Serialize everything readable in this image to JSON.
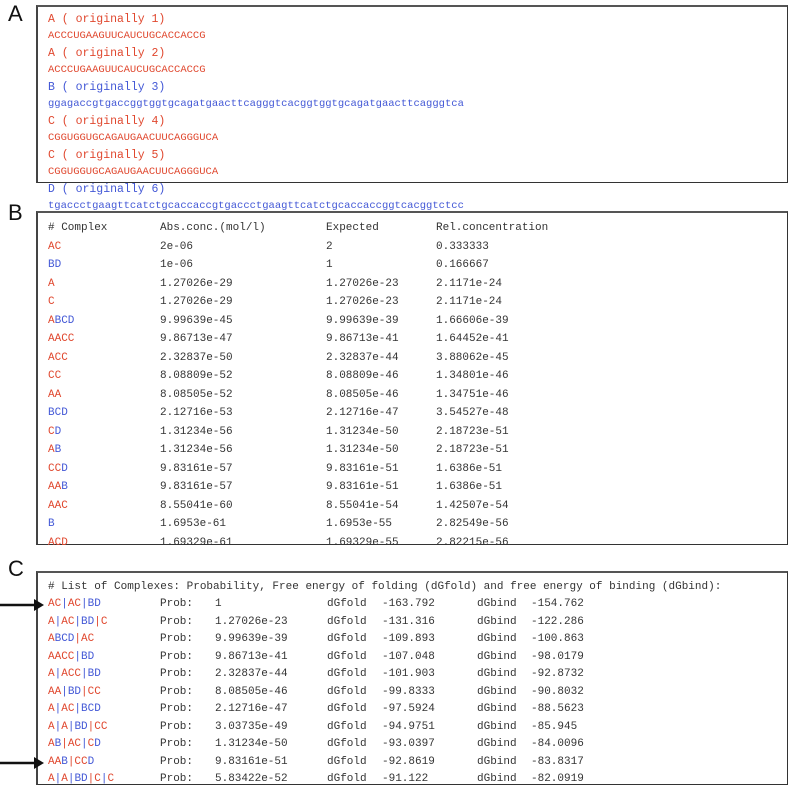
{
  "colors": {
    "strand_red": "#e0482f",
    "strand_blue": "#4358d6",
    "text": "#333333"
  },
  "red_strands": [
    "A",
    "C"
  ],
  "blue_strands": [
    "B",
    "D"
  ],
  "panel_labels": {
    "a": "A",
    "b": "B",
    "c": "C"
  },
  "panel_a": {
    "strands": [
      {
        "header": "A ( originally 1)",
        "sequence": "ACCCUGAAGUUCAUCUGCACCACCG",
        "color": "red"
      },
      {
        "header": "A ( originally 2)",
        "sequence": "ACCCUGAAGUUCAUCUGCACCACCG",
        "color": "red"
      },
      {
        "header": "B ( originally 3)",
        "sequence": "ggagaccgtgaccggtggtgcagatgaacttcagggtcacggtggtgcagatgaacttcagggtca",
        "color": "blue"
      },
      {
        "header": "C ( originally 4)",
        "sequence": "CGGUGGUGCAGAUGAACUUCAGGGUCA",
        "color": "red"
      },
      {
        "header": "C ( originally 5)",
        "sequence": "CGGUGGUGCAGAUGAACUUCAGGGUCA",
        "color": "red"
      },
      {
        "header": "D ( originally 6)",
        "sequence": "tgaccctgaagttcatctgcaccaccgtgaccctgaagttcatctgcaccaccggtcacggtctcc",
        "color": "blue"
      }
    ]
  },
  "panel_b": {
    "columns": [
      "# Complex",
      "Abs.conc.(mol/l)",
      "Expected",
      "Rel.concentration"
    ],
    "rows": [
      {
        "complex": [
          [
            "AC",
            "red"
          ]
        ],
        "abs": "2e-06",
        "expected": "2",
        "rel": "0.333333"
      },
      {
        "complex": [
          [
            "BD",
            "blue"
          ]
        ],
        "abs": "1e-06",
        "expected": "1",
        "rel": "0.166667"
      },
      {
        "complex": [
          [
            "A",
            "red"
          ]
        ],
        "abs": "1.27026e-29",
        "expected": "1.27026e-23",
        "rel": "2.1171e-24"
      },
      {
        "complex": [
          [
            "C",
            "red"
          ]
        ],
        "abs": "1.27026e-29",
        "expected": "1.27026e-23",
        "rel": "2.1171e-24"
      },
      {
        "complex": [
          [
            "A",
            "red"
          ],
          [
            "BCD",
            "blue"
          ]
        ],
        "abs": "9.99639e-45",
        "expected": "9.99639e-39",
        "rel": "1.66606e-39"
      },
      {
        "complex": [
          [
            "AACC",
            "red"
          ]
        ],
        "abs": "9.86713e-47",
        "expected": "9.86713e-41",
        "rel": "1.64452e-41"
      },
      {
        "complex": [
          [
            "ACC",
            "red"
          ]
        ],
        "abs": "2.32837e-50",
        "expected": "2.32837e-44",
        "rel": "3.88062e-45"
      },
      {
        "complex": [
          [
            "CC",
            "red"
          ]
        ],
        "abs": "8.08809e-52",
        "expected": "8.08809e-46",
        "rel": "1.34801e-46"
      },
      {
        "complex": [
          [
            "AA",
            "red"
          ]
        ],
        "abs": "8.08505e-52",
        "expected": "8.08505e-46",
        "rel": "1.34751e-46"
      },
      {
        "complex": [
          [
            "BCD",
            "blue"
          ]
        ],
        "abs": "2.12716e-53",
        "expected": "2.12716e-47",
        "rel": "3.54527e-48"
      },
      {
        "complex": [
          [
            "C",
            "red"
          ],
          [
            "D",
            "blue"
          ]
        ],
        "abs": "1.31234e-56",
        "expected": "1.31234e-50",
        "rel": "2.18723e-51"
      },
      {
        "complex": [
          [
            "A",
            "red"
          ],
          [
            "B",
            "blue"
          ]
        ],
        "abs": "1.31234e-56",
        "expected": "1.31234e-50",
        "rel": "2.18723e-51"
      },
      {
        "complex": [
          [
            "CC",
            "red"
          ],
          [
            "D",
            "blue"
          ]
        ],
        "abs": "9.83161e-57",
        "expected": "9.83161e-51",
        "rel": "1.6386e-51"
      },
      {
        "complex": [
          [
            "AA",
            "red"
          ],
          [
            "B",
            "blue"
          ]
        ],
        "abs": "9.83161e-57",
        "expected": "9.83161e-51",
        "rel": "1.6386e-51"
      },
      {
        "complex": [
          [
            "AAC",
            "red"
          ]
        ],
        "abs": "8.55041e-60",
        "expected": "8.55041e-54",
        "rel": "1.42507e-54"
      },
      {
        "complex": [
          [
            "B",
            "blue"
          ]
        ],
        "abs": "1.6953e-61",
        "expected": "1.6953e-55",
        "rel": "2.82549e-56"
      },
      {
        "complex": [
          [
            "ACD",
            "red"
          ]
        ],
        "abs": "1.69329e-61",
        "expected": "1.69329e-55",
        "rel": "2.82215e-56"
      }
    ]
  },
  "panel_c": {
    "header": "# List of Complexes: Probability, Free energy of folding (dGfold) and free energy of binding (dGbind):",
    "prob_label": "Prob:",
    "fold_label": "dGfold",
    "bind_label": "dGbind",
    "rows": [
      {
        "complex": [
          [
            "AC",
            "red"
          ],
          [
            "|",
            "blue"
          ],
          [
            "AC",
            "red"
          ],
          [
            "|",
            "blue"
          ],
          [
            "BD",
            "blue"
          ]
        ],
        "prob": "1",
        "dgfold": "-163.792",
        "dgbind": "-154.762",
        "arrow": true
      },
      {
        "complex": [
          [
            "A",
            "red"
          ],
          [
            "|",
            "blue"
          ],
          [
            "AC",
            "red"
          ],
          [
            "|",
            "blue"
          ],
          [
            "BD",
            "blue"
          ],
          [
            "|",
            "red"
          ],
          [
            "C",
            "red"
          ]
        ],
        "prob": "1.27026e-23",
        "dgfold": "-131.316",
        "dgbind": "-122.286",
        "arrow": false
      },
      {
        "complex": [
          [
            "A",
            "red"
          ],
          [
            "BCD",
            "blue"
          ],
          [
            "|",
            "red"
          ],
          [
            "AC",
            "red"
          ]
        ],
        "prob": "9.99639e-39",
        "dgfold": "-109.893",
        "dgbind": "-100.863",
        "arrow": false
      },
      {
        "complex": [
          [
            "AACC",
            "red"
          ],
          [
            "|",
            "blue"
          ],
          [
            "BD",
            "blue"
          ]
        ],
        "prob": "9.86713e-41",
        "dgfold": "-107.048",
        "dgbind": "-98.0179",
        "arrow": false
      },
      {
        "complex": [
          [
            "A",
            "red"
          ],
          [
            "|",
            "blue"
          ],
          [
            "ACC",
            "red"
          ],
          [
            "|",
            "blue"
          ],
          [
            "BD",
            "blue"
          ]
        ],
        "prob": "2.32837e-44",
        "dgfold": "-101.903",
        "dgbind": "-92.8732",
        "arrow": false
      },
      {
        "complex": [
          [
            "AA",
            "red"
          ],
          [
            "|",
            "blue"
          ],
          [
            "BD",
            "blue"
          ],
          [
            "|",
            "red"
          ],
          [
            "CC",
            "red"
          ]
        ],
        "prob": "8.08505e-46",
        "dgfold": "-99.8333",
        "dgbind": "-90.8032",
        "arrow": false
      },
      {
        "complex": [
          [
            "A",
            "red"
          ],
          [
            "|",
            "blue"
          ],
          [
            "AC",
            "red"
          ],
          [
            "|",
            "blue"
          ],
          [
            "BCD",
            "blue"
          ]
        ],
        "prob": "2.12716e-47",
        "dgfold": "-97.5924",
        "dgbind": "-88.5623",
        "arrow": false
      },
      {
        "complex": [
          [
            "A",
            "red"
          ],
          [
            "|",
            "blue"
          ],
          [
            "A",
            "red"
          ],
          [
            "|",
            "blue"
          ],
          [
            "BD",
            "blue"
          ],
          [
            "|",
            "red"
          ],
          [
            "CC",
            "red"
          ]
        ],
        "prob": "3.03735e-49",
        "dgfold": "-94.9751",
        "dgbind": "-85.945",
        "arrow": false
      },
      {
        "complex": [
          [
            "A",
            "red"
          ],
          [
            "B",
            "blue"
          ],
          [
            "|",
            "red"
          ],
          [
            "AC",
            "red"
          ],
          [
            "|",
            "blue"
          ],
          [
            "C",
            "red"
          ],
          [
            "D",
            "blue"
          ]
        ],
        "prob": "1.31234e-50",
        "dgfold": "-93.0397",
        "dgbind": "-84.0096",
        "arrow": false
      },
      {
        "complex": [
          [
            "AA",
            "red"
          ],
          [
            "B",
            "blue"
          ],
          [
            "|",
            "red"
          ],
          [
            "CC",
            "red"
          ],
          [
            "D",
            "blue"
          ]
        ],
        "prob": "9.83161e-51",
        "dgfold": "-92.8619",
        "dgbind": "-83.8317",
        "arrow": true
      },
      {
        "complex": [
          [
            "A",
            "red"
          ],
          [
            "|",
            "blue"
          ],
          [
            "A",
            "red"
          ],
          [
            "|",
            "blue"
          ],
          [
            "BD",
            "blue"
          ],
          [
            "|",
            "red"
          ],
          [
            "C",
            "red"
          ],
          [
            "|",
            "blue"
          ],
          [
            "C",
            "red"
          ]
        ],
        "prob": "5.83422e-52",
        "dgfold": "-91.122",
        "dgbind": "-82.0919",
        "arrow": false
      }
    ]
  }
}
